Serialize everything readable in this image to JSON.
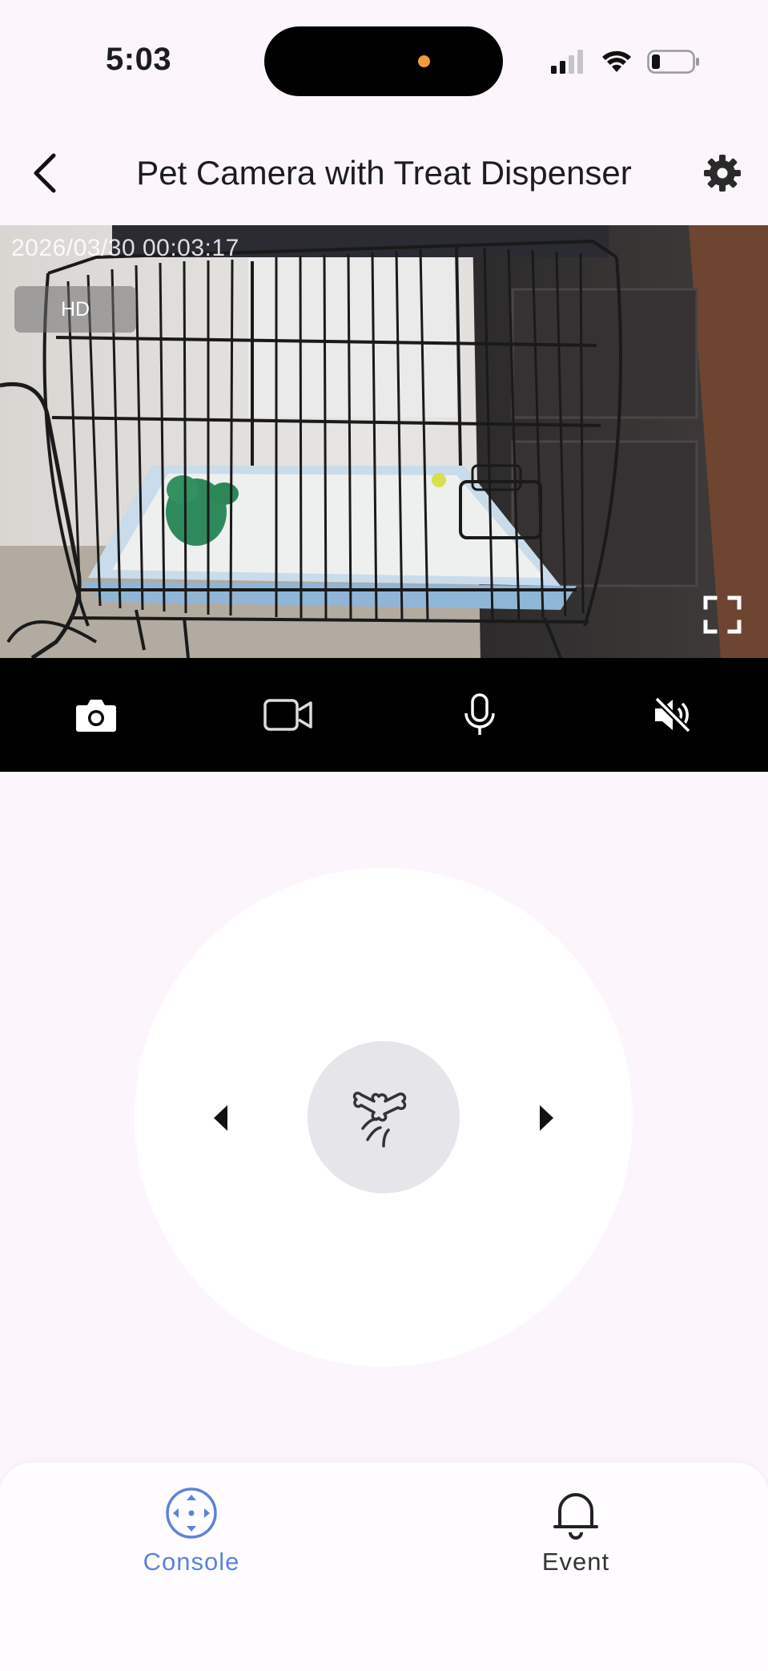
{
  "status_bar": {
    "time": "5:03"
  },
  "header": {
    "title": "Pet Camera with Treat Dispenser"
  },
  "video": {
    "timestamp": "2026/03/30 00:03:17",
    "quality": "HD"
  },
  "toolbar": {
    "icons": [
      "camera-icon",
      "video-record-icon",
      "microphone-icon",
      "speaker-muted-icon"
    ]
  },
  "controls": {
    "center_icon": "bone-treat-icon",
    "left_icon": "triangle-left-icon",
    "right_icon": "triangle-right-icon"
  },
  "bottom_nav": {
    "items": [
      {
        "label": "Console",
        "icon": "console-icon",
        "active": true
      },
      {
        "label": "Event",
        "icon": "bell-icon",
        "active": false
      }
    ]
  },
  "colors": {
    "accent": "#5b82e0",
    "background": "#fcf6fc",
    "toolbar": "#000000",
    "island_dot": "#f19a3e"
  }
}
